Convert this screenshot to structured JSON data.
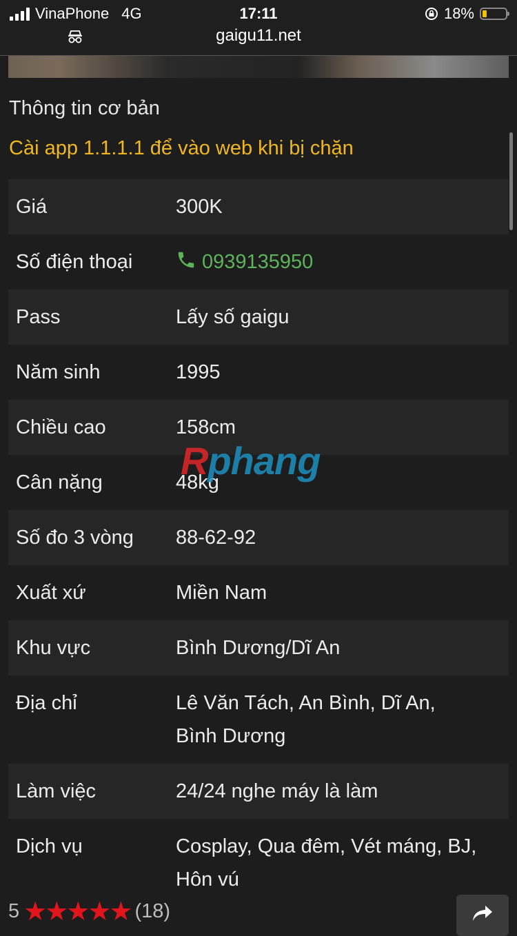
{
  "status_bar": {
    "carrier": "VinaPhone",
    "network": "4G",
    "time": "17:11",
    "battery_percent": "18%",
    "battery_level": 0.18,
    "url": "gaigu11.net"
  },
  "section": {
    "title": "Thông tin cơ bản",
    "notice": "Cài app 1.1.1.1 để vào web khi bị chặn"
  },
  "rows": [
    {
      "label": "Giá",
      "value": "300K"
    },
    {
      "label": "Số điện thoại",
      "value": "0939135950"
    },
    {
      "label": "Pass",
      "value": "Lấy số gaigu"
    },
    {
      "label": "Năm sinh",
      "value": "1995"
    },
    {
      "label": "Chiều cao",
      "value": "158cm"
    },
    {
      "label": "Cân nặng",
      "value": "48kg"
    },
    {
      "label": "Số đo 3 vòng",
      "value": "88-62-92"
    },
    {
      "label": "Xuất xứ",
      "value": "Miền Nam"
    },
    {
      "label": "Khu vực",
      "value": "Bình Dương/Dĩ An"
    },
    {
      "label": "Địa chỉ",
      "value": "Lê Văn Tách, An Bình, Dĩ An, Bình Dương"
    },
    {
      "label": "Làm việc",
      "value": "24/24 nghe máy là làm"
    },
    {
      "label": "Dịch vụ",
      "value": "Cosplay, Qua đêm, Vét máng, BJ, Hôn vú"
    }
  ],
  "watermark": {
    "part1": "R",
    "part2": "phang"
  },
  "rating": {
    "score": "5",
    "stars": "★★★★★",
    "count": "(18)"
  },
  "colors": {
    "accent_notice": "#f0b81e",
    "phone": "#5db35a",
    "star": "#e3151c"
  },
  "icons": [
    "signal-icon",
    "lock-rotation-icon",
    "battery-icon",
    "incognito-icon",
    "phone-icon",
    "star-icon",
    "share-icon"
  ]
}
